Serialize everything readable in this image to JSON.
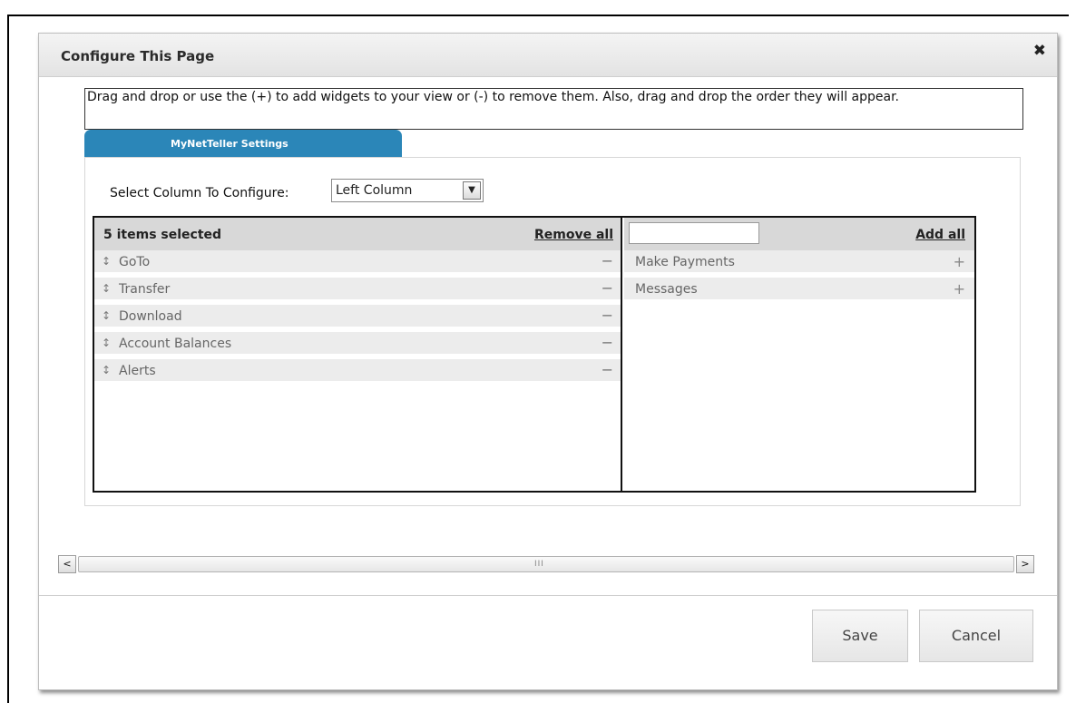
{
  "dialog": {
    "title": "Configure This Page",
    "close_icon": "close-icon"
  },
  "instructions": "Drag and drop or use the (+) to add widgets to your view or (-) to remove them. Also, drag and drop the order they will appear.",
  "tab": {
    "label": "MyNetTeller Settings"
  },
  "column_select": {
    "label": "Select Column To Configure:",
    "value": "Left Column"
  },
  "selected_list": {
    "count_text": "5 items selected",
    "remove_all": "Remove all",
    "items": [
      "GoTo",
      "Transfer",
      "Download",
      "Account Balances",
      "Alerts"
    ],
    "drag_glyph": "↕",
    "remove_glyph": "−"
  },
  "available_list": {
    "search_value": "",
    "add_all": "Add all",
    "items": [
      "Make Payments",
      "Messages"
    ],
    "add_glyph": "+"
  },
  "scrollbar": {
    "left_glyph": "<",
    "right_glyph": ">",
    "grip": "III"
  },
  "buttons": {
    "save": "Save",
    "cancel": "Cancel"
  }
}
